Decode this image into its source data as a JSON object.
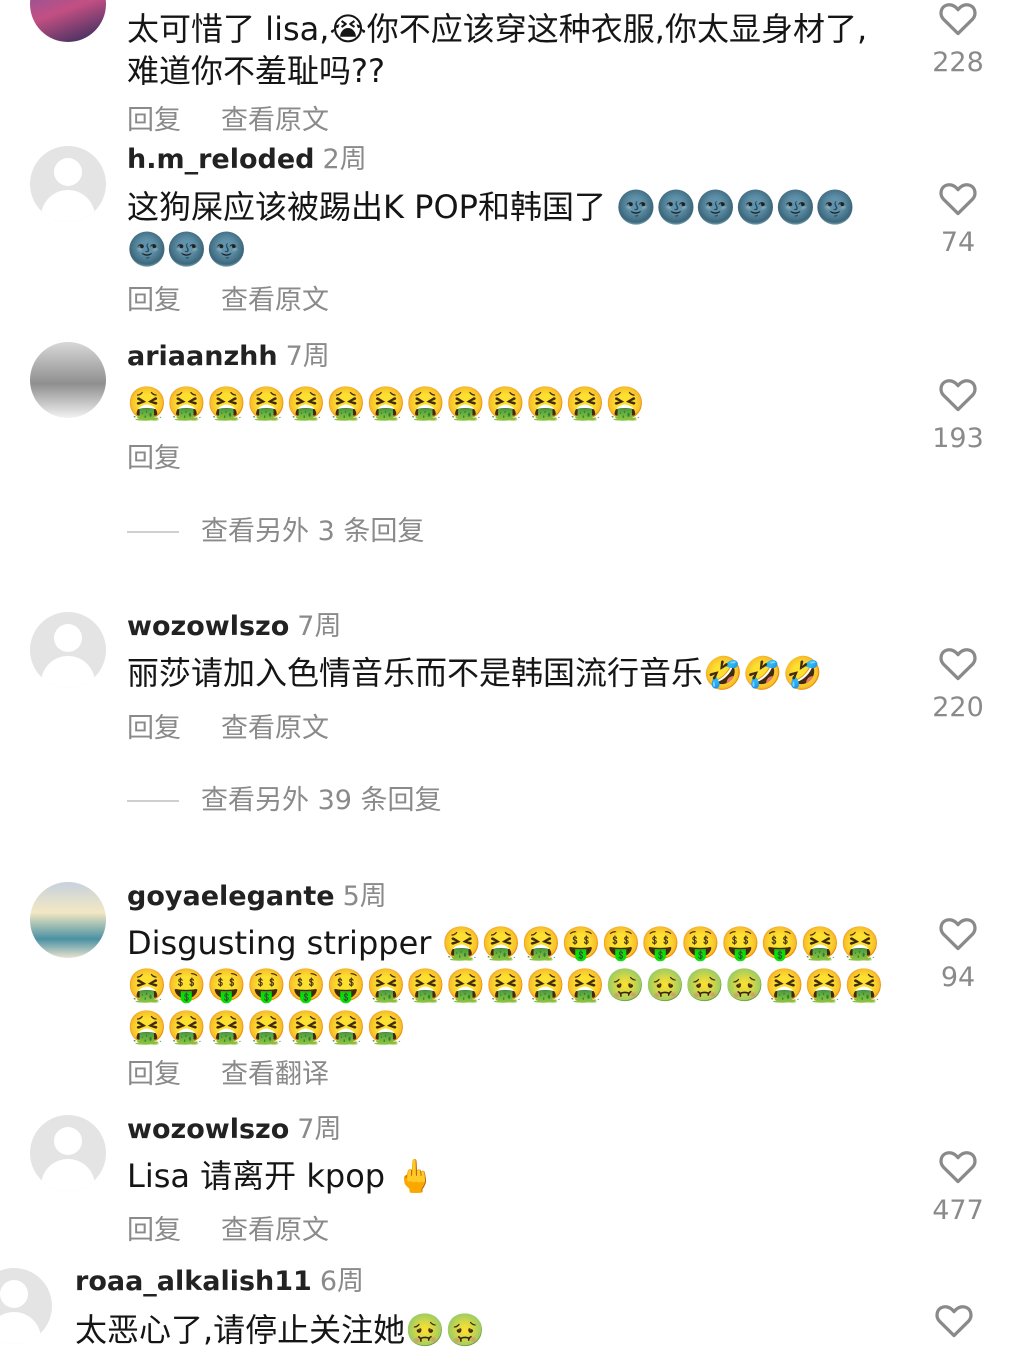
{
  "comments": [
    {
      "text": "太可惜了 lisa,😭你不应该穿这种衣服,你太显身材了,难道你不羞耻吗??",
      "actions": [
        "回复",
        "查看原文"
      ],
      "likes": "228",
      "avatar": "photo"
    },
    {
      "username": "h.m_reloded",
      "age": "2周",
      "text": "这狗屎应该被踢出K POP和韩国了 🌚🌚🌚🌚🌚🌚🌚🌚🌚",
      "actions": [
        "回复",
        "查看原文"
      ],
      "likes": "74",
      "avatar": "placeholder"
    },
    {
      "username": "ariaanzhh",
      "age": "7周",
      "text": "🤮🤮🤮🤮🤮🤮🤮🤮🤮🤮🤮🤮🤮",
      "actions": [
        "回复"
      ],
      "likes": "193",
      "avatar": "photo"
    },
    {
      "username": "wozowlszo",
      "age": "7周",
      "text": "丽莎请加入色情音乐而不是韩国流行音乐🤣🤣🤣",
      "actions": [
        "回复",
        "查看原文"
      ],
      "likes": "220",
      "avatar": "placeholder"
    },
    {
      "username": "goyaelegante",
      "age": "5周",
      "text": "Disgusting stripper 🤮🤮🤮🤑🤑🤑🤑🤑🤑🤮🤮🤮🤑🤑🤑🤑🤑🤮🤮🤮🤮🤮🤮🤢🤢🤢🤢🤮🤮🤮🤮🤮🤮🤮🤮🤮🤮",
      "actions": [
        "回复",
        "查看翻译"
      ],
      "likes": "94",
      "avatar": "photo"
    },
    {
      "username": "wozowlszo",
      "age": "7周",
      "text": "Lisa 请离开 kpop 🖕",
      "actions": [
        "回复",
        "查看原文"
      ],
      "likes": "477",
      "avatar": "placeholder"
    },
    {
      "username": "roaa_alkalish11",
      "age": "6周",
      "text": "太恶心了,请停止关注她🤢🤢",
      "actions": [],
      "likes": "",
      "avatar": "placeholder"
    }
  ],
  "view_more": [
    "查看另外 3 条回复",
    "查看另外 39 条回复"
  ],
  "icons": {
    "like": "heart-outline-icon"
  },
  "colors": {
    "text": "#151515",
    "secondary": "#8a8a8a",
    "placeholder_avatar": "#e4e4e4"
  }
}
